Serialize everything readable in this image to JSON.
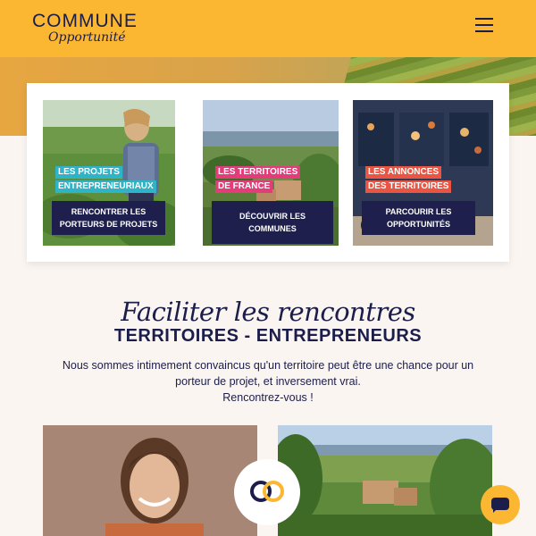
{
  "header": {
    "logo_main": "COMMUNE",
    "logo_sub": "Opportunité",
    "menu_icon": "hamburger-icon",
    "background": "#fbb731"
  },
  "cards": [
    {
      "tag_lines": [
        "LES PROJETS",
        "ENTREPRENEURIAUX"
      ],
      "tag_color": "#2fb3c6",
      "button": "RENCONTRER LES PORTEURS DE PROJETS"
    },
    {
      "tag_lines": [
        "LES TERRITOIRES",
        "DE FRANCE"
      ],
      "tag_color": "#e23d78",
      "button": "DÉCOUVRIR LES COMMUNES"
    },
    {
      "tag_lines": [
        "LES ANNONCES",
        "DES TERRITOIRES"
      ],
      "tag_color": "#e95542",
      "button": "PARCOURIR LES OPPORTUNITÉS"
    }
  ],
  "section": {
    "script_title": "Faciliter les rencontres",
    "title": "TERRITOIRES - ENTREPRENEURS",
    "text_line1": "Nous sommes intimement convaincus qu'un territoire peut être une chance pour un porteur de projet, et inversement vrai.",
    "text_line2": "Rencontrez-vous !"
  },
  "colors": {
    "navy": "#1b1d4a",
    "accent": "#fbb731",
    "ring_left": "#1b1d4a",
    "ring_right": "#fbb731"
  },
  "chat": {
    "icon": "chat-bubble-icon"
  }
}
